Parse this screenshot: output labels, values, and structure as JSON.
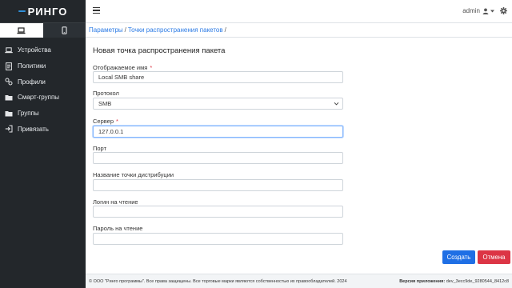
{
  "brand": {
    "name": "РИНГО"
  },
  "sidebar": {
    "device_tabs": [
      {
        "icon": "laptop-icon",
        "active": true
      },
      {
        "icon": "mobile-icon",
        "active": false
      }
    ],
    "items": [
      {
        "label": "Устройства",
        "icon": "laptop-icon"
      },
      {
        "label": "Политики",
        "icon": "document-icon"
      },
      {
        "label": "Профили",
        "icon": "profiles-icon"
      },
      {
        "label": "Смарт-группы",
        "icon": "folder-icon"
      },
      {
        "label": "Группы",
        "icon": "folder-icon"
      },
      {
        "label": "Привязать",
        "icon": "sign-in-icon"
      }
    ]
  },
  "topbar": {
    "user": "admin"
  },
  "breadcrumb": {
    "items": [
      "Параметры",
      "Точки распространения пакетов"
    ],
    "separator": "/"
  },
  "form": {
    "title": "Новая точка распространения пакета",
    "display_name": {
      "label": "Отображаемое имя",
      "required_mark": "*",
      "value": "Local SMB share"
    },
    "protocol": {
      "label": "Протокол",
      "value": "SMB"
    },
    "server": {
      "label": "Сервер",
      "required_mark": "*",
      "value": "127.0.0.1"
    },
    "port": {
      "label": "Порт",
      "value": ""
    },
    "share_name": {
      "label": "Название точки дистрибуции",
      "value": ""
    },
    "read_login": {
      "label": "Логин на чтение",
      "value": ""
    },
    "read_password": {
      "label": "Пароль на чтение",
      "value": ""
    },
    "create_label": "Создать",
    "cancel_label": "Отмена"
  },
  "footer": {
    "copyright": "© ООО \"Ринго программы\". Все права защищены. Все торговые марки являются собственностью их правообладателей. 2024",
    "version_label": "Версия приложения:",
    "version_value": "dev_3ecc9de_9280544_8412c8"
  },
  "colors": {
    "sidebar_bg": "#23272b",
    "accent": "#1f6fe5",
    "danger": "#dc3545",
    "link": "#2c7be5"
  }
}
